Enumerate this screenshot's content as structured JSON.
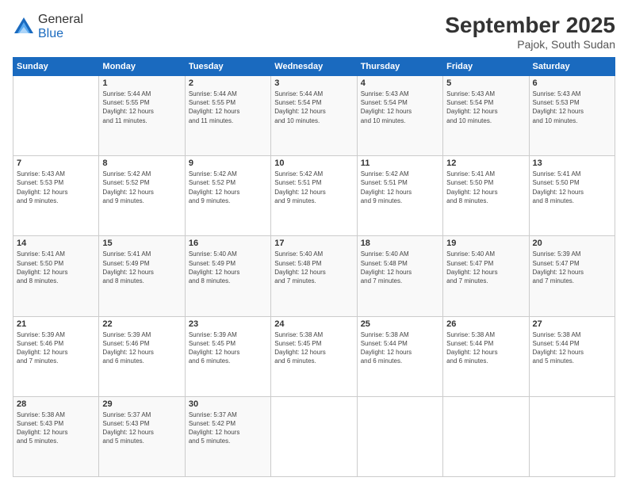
{
  "logo": {
    "general": "General",
    "blue": "Blue"
  },
  "header": {
    "month": "September 2025",
    "location": "Pajok, South Sudan"
  },
  "weekdays": [
    "Sunday",
    "Monday",
    "Tuesday",
    "Wednesday",
    "Thursday",
    "Friday",
    "Saturday"
  ],
  "weeks": [
    [
      {
        "day": "",
        "info": ""
      },
      {
        "day": "1",
        "info": "Sunrise: 5:44 AM\nSunset: 5:55 PM\nDaylight: 12 hours\nand 11 minutes."
      },
      {
        "day": "2",
        "info": "Sunrise: 5:44 AM\nSunset: 5:55 PM\nDaylight: 12 hours\nand 11 minutes."
      },
      {
        "day": "3",
        "info": "Sunrise: 5:44 AM\nSunset: 5:54 PM\nDaylight: 12 hours\nand 10 minutes."
      },
      {
        "day": "4",
        "info": "Sunrise: 5:43 AM\nSunset: 5:54 PM\nDaylight: 12 hours\nand 10 minutes."
      },
      {
        "day": "5",
        "info": "Sunrise: 5:43 AM\nSunset: 5:54 PM\nDaylight: 12 hours\nand 10 minutes."
      },
      {
        "day": "6",
        "info": "Sunrise: 5:43 AM\nSunset: 5:53 PM\nDaylight: 12 hours\nand 10 minutes."
      }
    ],
    [
      {
        "day": "7",
        "info": "Sunrise: 5:43 AM\nSunset: 5:53 PM\nDaylight: 12 hours\nand 9 minutes."
      },
      {
        "day": "8",
        "info": "Sunrise: 5:42 AM\nSunset: 5:52 PM\nDaylight: 12 hours\nand 9 minutes."
      },
      {
        "day": "9",
        "info": "Sunrise: 5:42 AM\nSunset: 5:52 PM\nDaylight: 12 hours\nand 9 minutes."
      },
      {
        "day": "10",
        "info": "Sunrise: 5:42 AM\nSunset: 5:51 PM\nDaylight: 12 hours\nand 9 minutes."
      },
      {
        "day": "11",
        "info": "Sunrise: 5:42 AM\nSunset: 5:51 PM\nDaylight: 12 hours\nand 9 minutes."
      },
      {
        "day": "12",
        "info": "Sunrise: 5:41 AM\nSunset: 5:50 PM\nDaylight: 12 hours\nand 8 minutes."
      },
      {
        "day": "13",
        "info": "Sunrise: 5:41 AM\nSunset: 5:50 PM\nDaylight: 12 hours\nand 8 minutes."
      }
    ],
    [
      {
        "day": "14",
        "info": "Sunrise: 5:41 AM\nSunset: 5:50 PM\nDaylight: 12 hours\nand 8 minutes."
      },
      {
        "day": "15",
        "info": "Sunrise: 5:41 AM\nSunset: 5:49 PM\nDaylight: 12 hours\nand 8 minutes."
      },
      {
        "day": "16",
        "info": "Sunrise: 5:40 AM\nSunset: 5:49 PM\nDaylight: 12 hours\nand 8 minutes."
      },
      {
        "day": "17",
        "info": "Sunrise: 5:40 AM\nSunset: 5:48 PM\nDaylight: 12 hours\nand 7 minutes."
      },
      {
        "day": "18",
        "info": "Sunrise: 5:40 AM\nSunset: 5:48 PM\nDaylight: 12 hours\nand 7 minutes."
      },
      {
        "day": "19",
        "info": "Sunrise: 5:40 AM\nSunset: 5:47 PM\nDaylight: 12 hours\nand 7 minutes."
      },
      {
        "day": "20",
        "info": "Sunrise: 5:39 AM\nSunset: 5:47 PM\nDaylight: 12 hours\nand 7 minutes."
      }
    ],
    [
      {
        "day": "21",
        "info": "Sunrise: 5:39 AM\nSunset: 5:46 PM\nDaylight: 12 hours\nand 7 minutes."
      },
      {
        "day": "22",
        "info": "Sunrise: 5:39 AM\nSunset: 5:46 PM\nDaylight: 12 hours\nand 6 minutes."
      },
      {
        "day": "23",
        "info": "Sunrise: 5:39 AM\nSunset: 5:45 PM\nDaylight: 12 hours\nand 6 minutes."
      },
      {
        "day": "24",
        "info": "Sunrise: 5:38 AM\nSunset: 5:45 PM\nDaylight: 12 hours\nand 6 minutes."
      },
      {
        "day": "25",
        "info": "Sunrise: 5:38 AM\nSunset: 5:44 PM\nDaylight: 12 hours\nand 6 minutes."
      },
      {
        "day": "26",
        "info": "Sunrise: 5:38 AM\nSunset: 5:44 PM\nDaylight: 12 hours\nand 6 minutes."
      },
      {
        "day": "27",
        "info": "Sunrise: 5:38 AM\nSunset: 5:44 PM\nDaylight: 12 hours\nand 5 minutes."
      }
    ],
    [
      {
        "day": "28",
        "info": "Sunrise: 5:38 AM\nSunset: 5:43 PM\nDaylight: 12 hours\nand 5 minutes."
      },
      {
        "day": "29",
        "info": "Sunrise: 5:37 AM\nSunset: 5:43 PM\nDaylight: 12 hours\nand 5 minutes."
      },
      {
        "day": "30",
        "info": "Sunrise: 5:37 AM\nSunset: 5:42 PM\nDaylight: 12 hours\nand 5 minutes."
      },
      {
        "day": "",
        "info": ""
      },
      {
        "day": "",
        "info": ""
      },
      {
        "day": "",
        "info": ""
      },
      {
        "day": "",
        "info": ""
      }
    ]
  ]
}
